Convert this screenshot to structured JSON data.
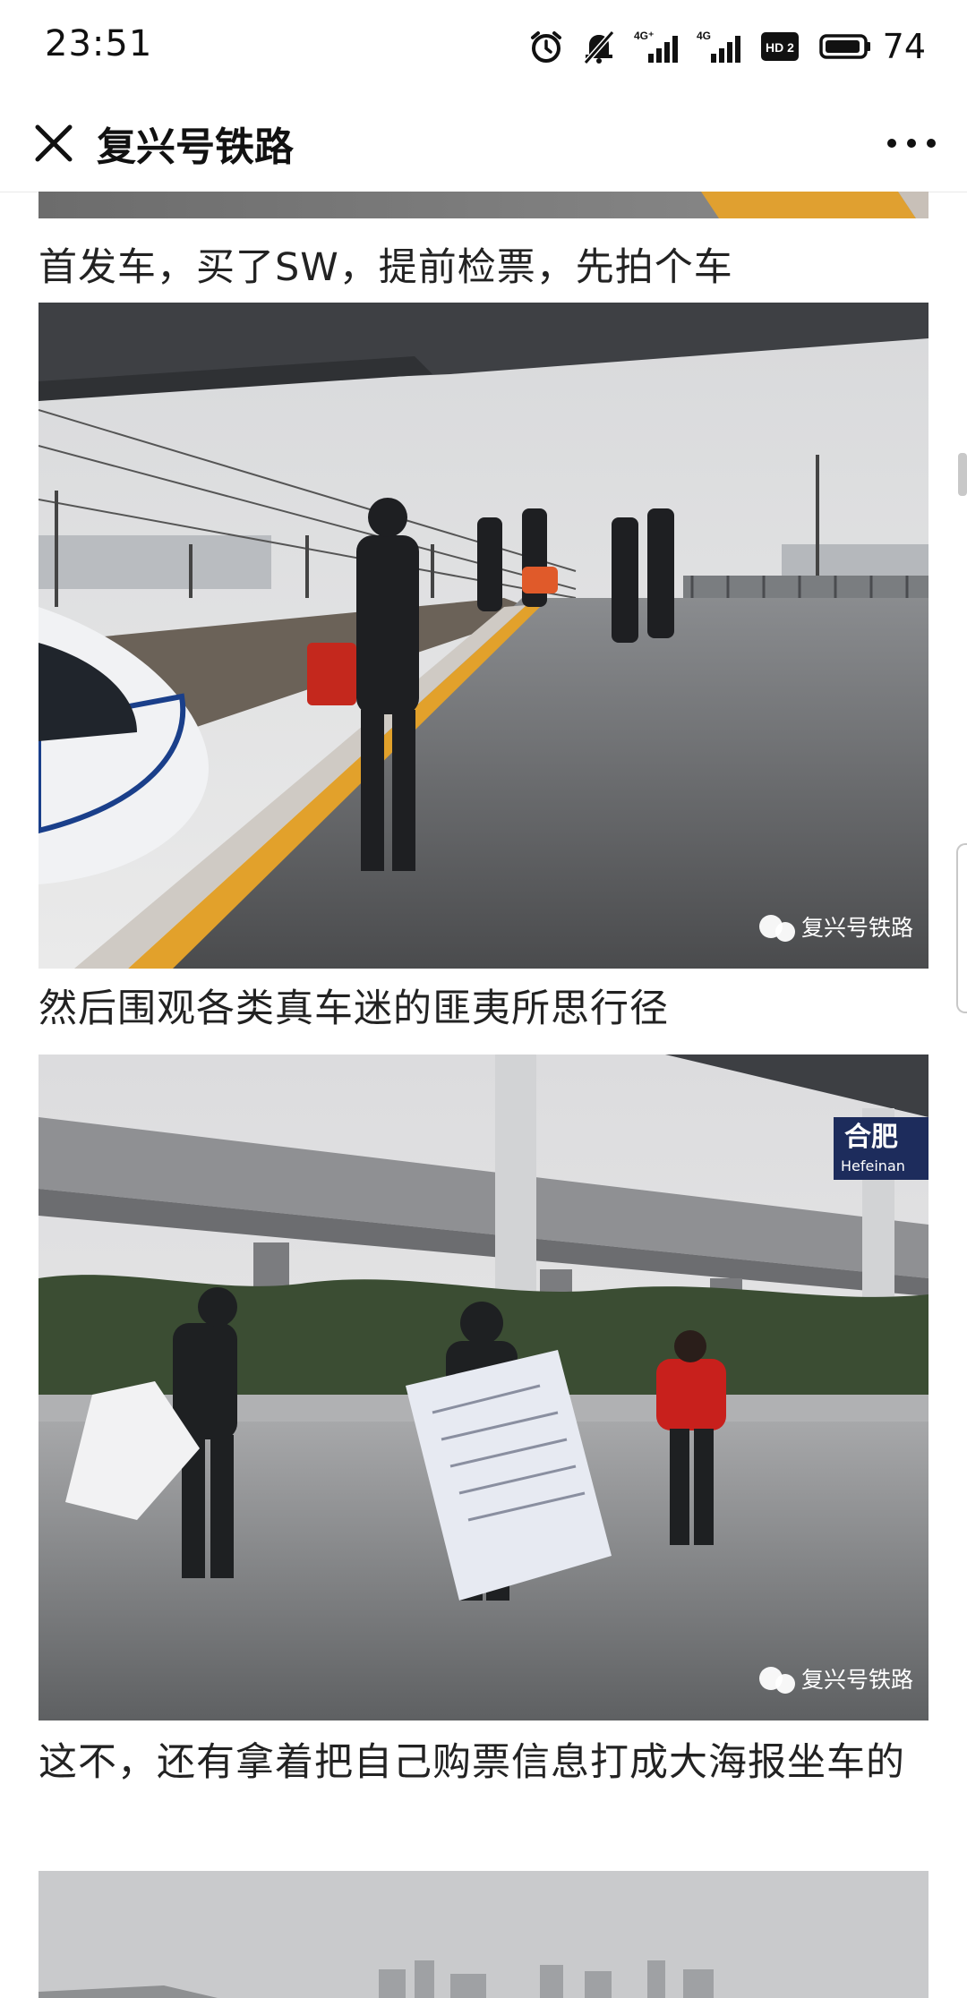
{
  "status_bar": {
    "time": "23:51",
    "battery": "74",
    "icons": [
      "alarm-icon",
      "mute-icon",
      "4g-signal-icon",
      "4g-signal-icon",
      "hd-icon",
      "battery-icon"
    ],
    "network_labels": [
      "4G⁺",
      "4G"
    ],
    "hd_label": "HD 2"
  },
  "nav": {
    "title": "复兴号铁路",
    "close_icon": "close-icon",
    "more_icon": "more-icon"
  },
  "article": {
    "watermark": "复兴号铁路",
    "captions": [
      "首发车，买了SW，提前检票，先拍个车",
      "然后围观各类真车迷的匪夷所思行径",
      "这不，还有拿着把自己购票信息打成大海报坐车的"
    ],
    "station_sign": {
      "cn": "合肥",
      "en": "Hefeinan"
    }
  },
  "colors": {
    "accent_yellow": "#e8a92a",
    "sign_blue": "#1d2c5c"
  }
}
